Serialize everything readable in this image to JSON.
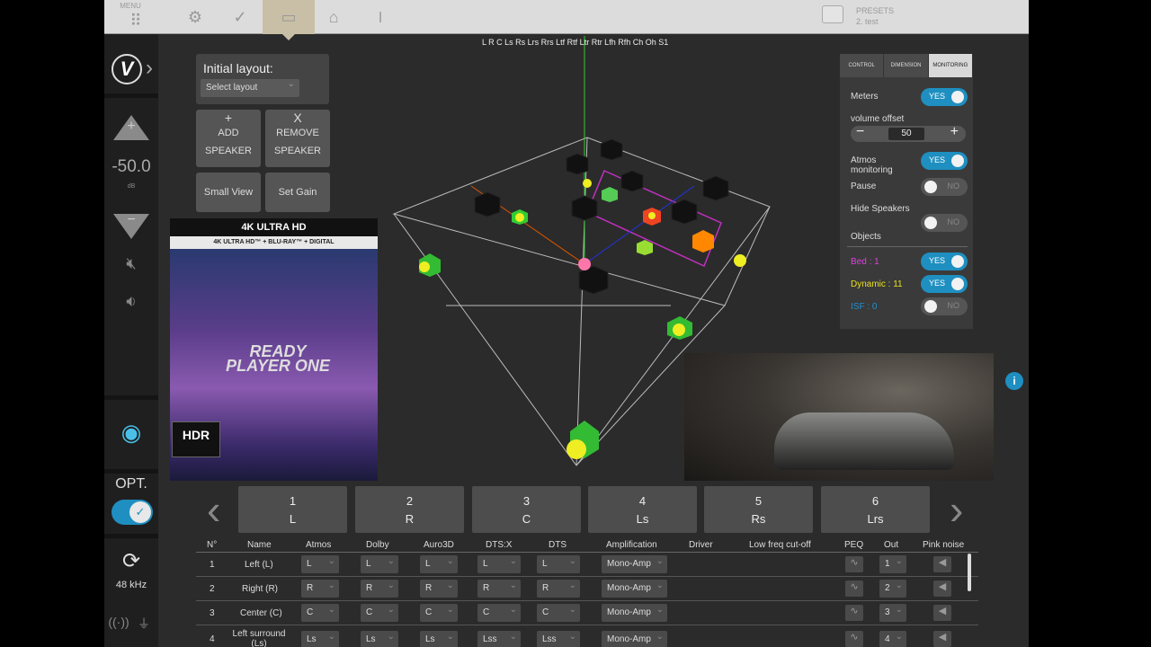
{
  "topbar": {
    "menu_label": "MENU",
    "presets_label": "PRESETS",
    "preset_name": "2. test",
    "buttons": [
      "grid-icon",
      "gear-icon",
      "check-icon",
      "tv-icon",
      "chart-icon",
      "bottle-icon"
    ]
  },
  "sidebar": {
    "volume_value": "-50.0",
    "volume_unit": "dB",
    "opt_label": "OPT.",
    "freq": "48 kHz"
  },
  "layout": {
    "title": "Initial layout:",
    "select_placeholder": "Select layout",
    "add_symbol": "+",
    "add_label": "ADD",
    "add_label2": "SPEAKER",
    "remove_symbol": "X",
    "remove_label": "REMOVE",
    "remove_label2": "SPEAKER",
    "small_view": "Small View",
    "set_gain": "Set Gain"
  },
  "poster": {
    "badge": "4K ULTRA HD",
    "band": "4K ULTRA HD™ + BLU-RAY™ + DIGITAL",
    "title": "READY PLAYER ONE",
    "hdr": "HDR"
  },
  "scene": {
    "channel_string": "L R C Ls Rs Lrs Rrs Ltf Rtf Ltr Rtr Lfh Rfh Ch Oh S1"
  },
  "monitoring": {
    "tabs": [
      "CONTROL",
      "DIMENSION",
      "MONITORING"
    ],
    "active_tab": "MONITORING",
    "meters_label": "Meters",
    "meters_value": "YES",
    "volume_offset_label": "volume offset",
    "volume_offset_value": "50",
    "atmos_label": "Atmos monitoring",
    "atmos_value": "YES",
    "pause_label": "Pause",
    "pause_value": "NO",
    "hide_label": "Hide Speakers",
    "hide_value": "NO",
    "objects_label": "Objects",
    "bed_label": "Bed : 1",
    "bed_value": "YES",
    "dynamic_label": "Dynamic : 11",
    "dynamic_value": "YES",
    "isf_label": "ISF : 0",
    "isf_value": "NO",
    "colors": {
      "bed": "#e040e0",
      "dynamic": "#e8e020",
      "isf": "#2090d0"
    }
  },
  "speakers": [
    {
      "num": "1",
      "label": "L"
    },
    {
      "num": "2",
      "label": "R"
    },
    {
      "num": "3",
      "label": "C"
    },
    {
      "num": "4",
      "label": "Ls"
    },
    {
      "num": "5",
      "label": "Rs"
    },
    {
      "num": "6",
      "label": "Lrs"
    }
  ],
  "table": {
    "headers": [
      "N°",
      "Name",
      "Atmos",
      "Dolby",
      "Auro3D",
      "DTS:X",
      "DTS",
      "Amplification",
      "Driver",
      "Low freq cut-off",
      "PEQ",
      "Out",
      "Pink noise"
    ],
    "rows": [
      {
        "n": "1",
        "name": "Left (L)",
        "atmos": "L",
        "dolby": "L",
        "auro": "L",
        "dtsx": "L",
        "dts": "L",
        "amp": "Mono-Amp",
        "out": "1"
      },
      {
        "n": "2",
        "name": "Right (R)",
        "atmos": "R",
        "dolby": "R",
        "auro": "R",
        "dtsx": "R",
        "dts": "R",
        "amp": "Mono-Amp",
        "out": "2"
      },
      {
        "n": "3",
        "name": "Center (C)",
        "atmos": "C",
        "dolby": "C",
        "auro": "C",
        "dtsx": "C",
        "dts": "C",
        "amp": "Mono-Amp",
        "out": "3"
      },
      {
        "n": "4",
        "name": "Left surround (Ls)",
        "atmos": "Ls",
        "dolby": "Ls",
        "auro": "Ls",
        "dtsx": "Lss",
        "dts": "Lss",
        "amp": "Mono-Amp",
        "out": "4"
      }
    ]
  }
}
